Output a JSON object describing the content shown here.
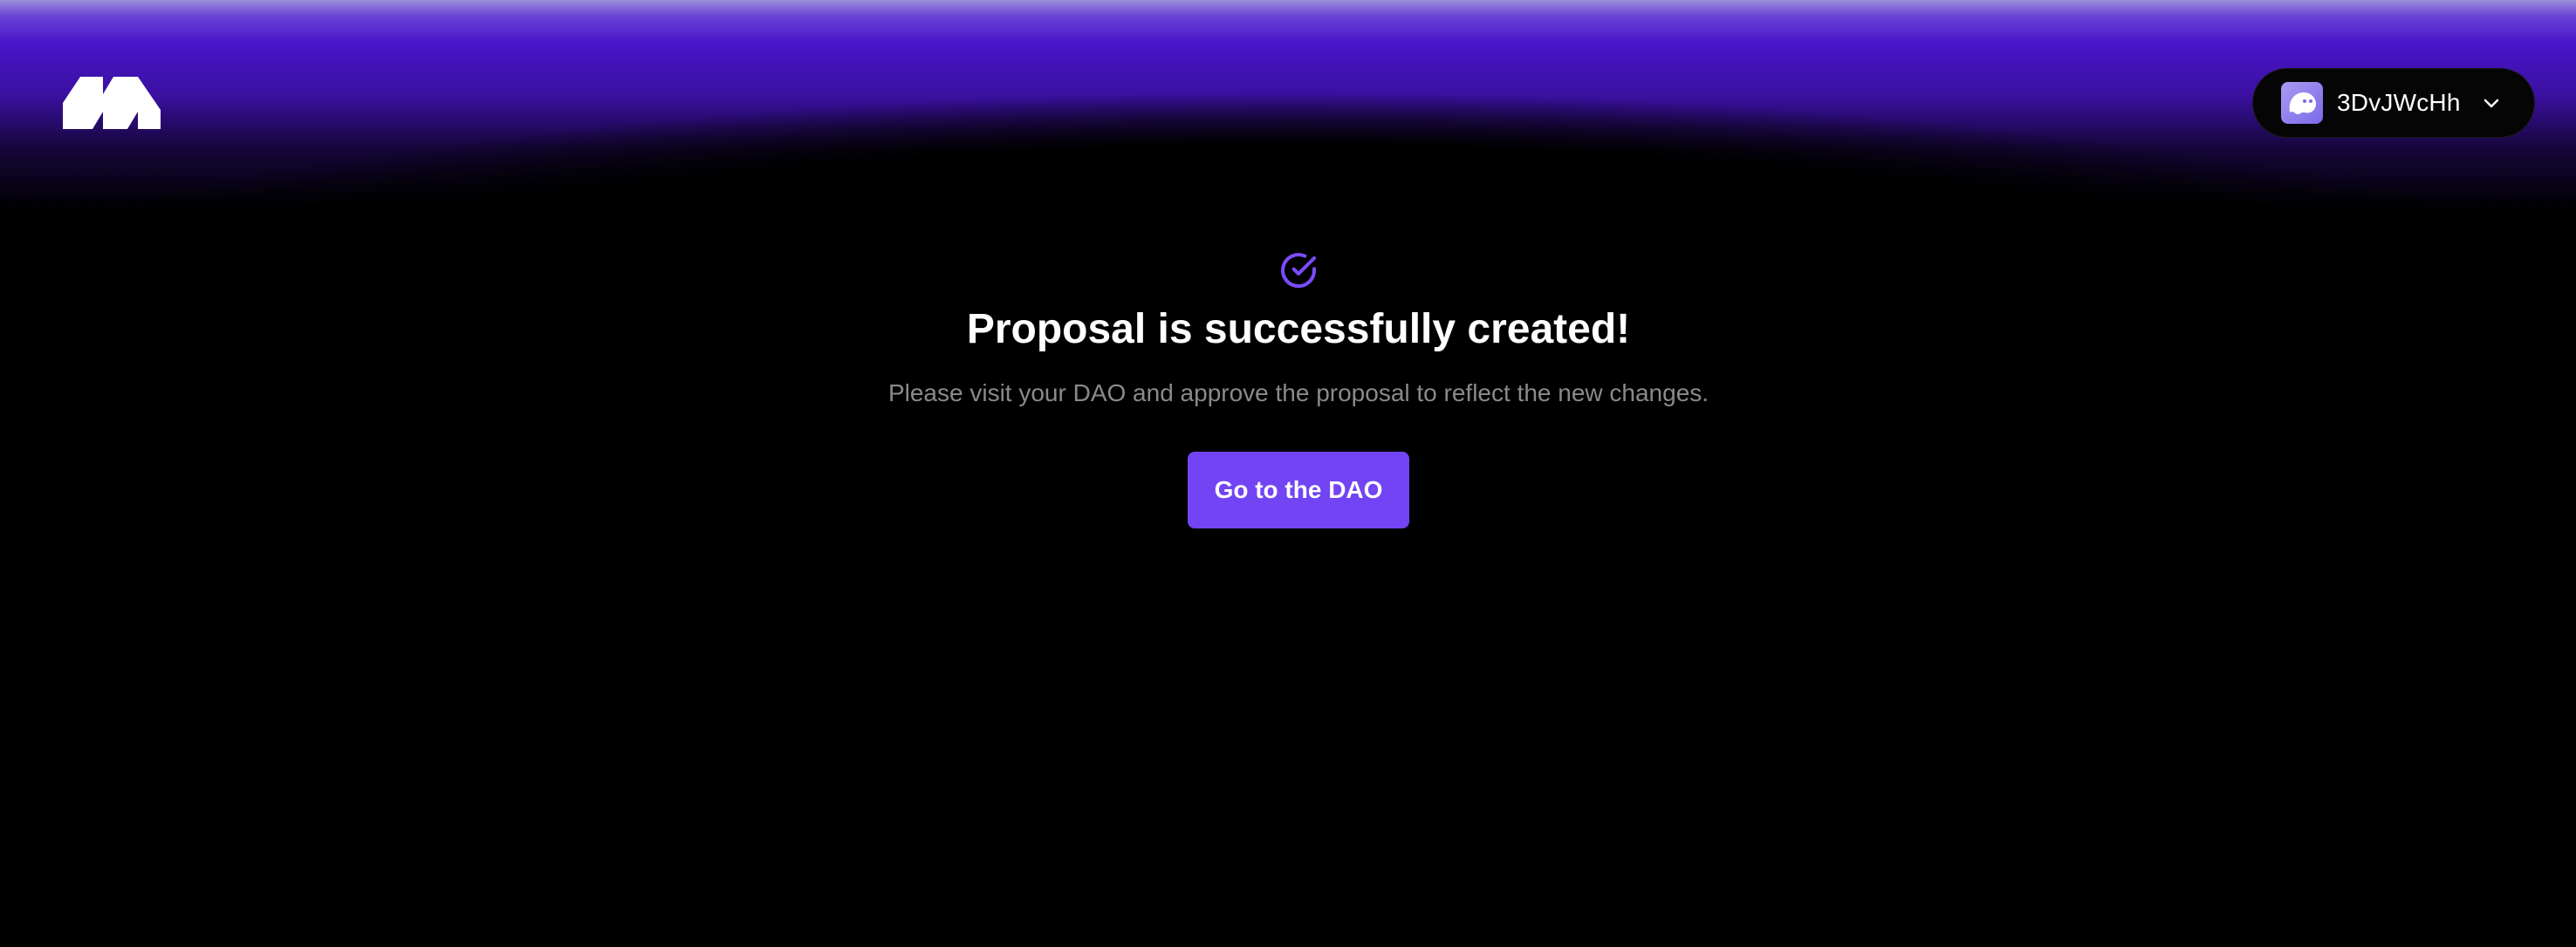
{
  "header": {
    "logo_icon": "brand-logo-icon",
    "wallet": {
      "address": "3DvJWcHh",
      "avatar_icon": "ghost-avatar-icon",
      "chevron_icon": "chevron-down-icon"
    }
  },
  "main": {
    "status_icon": "check-circle-icon",
    "title": "Proposal is successfully created!",
    "subtitle": "Please visit your DAO and approve the proposal to reflect the new changes.",
    "cta_label": "Go to the DAO"
  },
  "colors": {
    "background": "#000000",
    "accent": "#7244f4",
    "glow": "#4a14c8",
    "subtitle_text": "#8a8a8a"
  }
}
